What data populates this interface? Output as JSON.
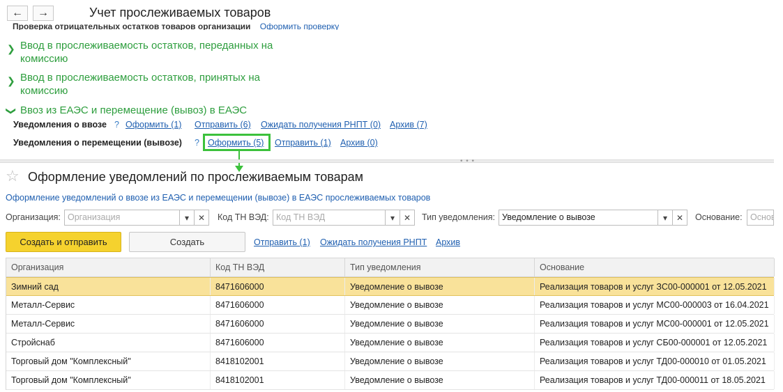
{
  "window": {
    "title": "Учет прослеживаемых товаров",
    "back_icon": "arrow-left-icon",
    "forward_icon": "arrow-right-icon"
  },
  "cut_line": {
    "label": "Проверка отрицательных остатков товаров организации",
    "link": "Оформить проверку"
  },
  "groups": [
    {
      "line1": "Ввод в прослеживаемость остатков, переданных на",
      "line2": "комиссию",
      "icon": "chevron-right-icon"
    },
    {
      "line1": "Ввод в прослеживаемость остатков, принятых на",
      "line2": "комиссию",
      "icon": "chevron-right-icon"
    },
    {
      "line1": "Ввоз из ЕАЭС и перемещение (вывоз) в ЕАЭС",
      "icon": "chevron-down-icon"
    }
  ],
  "notify_import": {
    "label": "Уведомления о ввозе",
    "help": "?",
    "links": [
      "Оформить (1)",
      "Отправить (6)",
      "Ожидать получения РНПТ (0)",
      "Архив (7)"
    ]
  },
  "notify_move": {
    "label": "Уведомления о перемещении (вывозе)",
    "help": "?",
    "links": [
      "Оформить (5)",
      "Отправить (1)",
      "Архив (0)"
    ]
  },
  "highlight_color": "#3cc13c",
  "form": {
    "title": "Оформление уведомлений по прослеживаемым товарам",
    "description": "Оформление уведомлений о ввозе из ЕАЭС и перемещении (вывозе) в ЕАЭС прослеживаемых товаров",
    "filters": {
      "org_label": "Организация:",
      "org_placeholder": "Организация",
      "code_label": "Код ТН ВЭД:",
      "code_placeholder": "Код ТН ВЭД",
      "type_label": "Тип уведомления:",
      "type_value": "Уведомление о вывозе",
      "basis_label": "Основание:",
      "basis_placeholder": "Основание"
    },
    "buttons": {
      "create_send": "Создать и отправить",
      "create": "Создать",
      "send": "Отправить (1)",
      "await": "Ожидать получения РНПТ",
      "archive": "Архив"
    }
  },
  "table": {
    "columns": [
      "Организация",
      "Код ТН ВЭД",
      "Тип уведомления",
      "Основание"
    ],
    "rows": [
      [
        "Зимний сад",
        "8471606000",
        "Уведомление о вывозе",
        "Реализация товаров и услуг ЗС00-000001 от 12.05.2021"
      ],
      [
        "Металл-Сервис",
        "8471606000",
        "Уведомление о вывозе",
        "Реализация товаров и услуг МС00-000003 от 16.04.2021"
      ],
      [
        "Металл-Сервис",
        "8471606000",
        "Уведомление о вывозе",
        "Реализация товаров и услуг МС00-000001 от 12.05.2021"
      ],
      [
        "Стройснаб",
        "8471606000",
        "Уведомление о вывозе",
        "Реализация товаров и услуг СБ00-000001 от 12.05.2021"
      ],
      [
        "Торговый дом \"Комплексный\"",
        "8418102001",
        "Уведомление о вывозе",
        "Реализация товаров и услуг ТД00-000010 от 01.05.2021"
      ],
      [
        "Торговый дом \"Комплексный\"",
        "8418102001",
        "Уведомление о вывозе",
        "Реализация товаров и услуг ТД00-000011 от 18.05.2021"
      ]
    ],
    "selected_row": 0,
    "selected_color": "#f9e29a"
  }
}
